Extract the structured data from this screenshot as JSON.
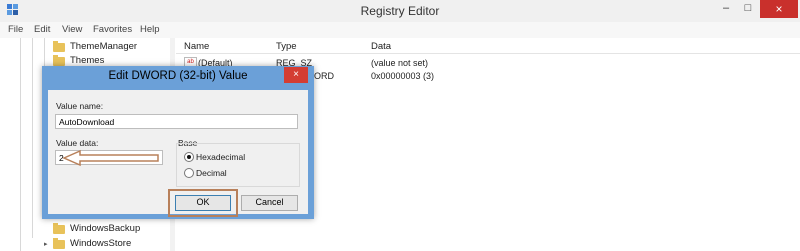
{
  "window": {
    "title": "Registry Editor",
    "close_glyph": "×",
    "minimize_glyph": "–",
    "maximize_glyph": "□"
  },
  "menu": [
    "File",
    "Edit",
    "View",
    "Favorites",
    "Help"
  ],
  "tree": [
    {
      "label": "ThemeManager"
    },
    {
      "label": "Themes"
    },
    {
      "label": "WindowsBackup"
    },
    {
      "label": "WindowsStore"
    }
  ],
  "list": {
    "headers": {
      "name": "Name",
      "type": "Type",
      "data": "Data"
    },
    "rows": [
      {
        "name": "(Default)",
        "type": "REG_SZ",
        "data": "(value not set)"
      },
      {
        "name": "",
        "type": "ORD",
        "data": "0x00000003 (3)"
      }
    ]
  },
  "dialog": {
    "title": "Edit DWORD (32-bit) Value",
    "close_glyph": "×",
    "value_name_label": "Value name:",
    "value_name": "AutoDownload",
    "value_data_label": "Value data:",
    "value_data": "2",
    "base_label": "Base",
    "hex_label": "Hexadecimal",
    "dec_label": "Decimal",
    "ok_label": "OK",
    "cancel_label": "Cancel"
  },
  "colors": {
    "dialog_border": "#6ba0d8",
    "close_red": "#d43d33",
    "annotation": "#b8805a",
    "folder": "#e8c25a"
  },
  "icons": [
    "registry-icon",
    "folder-icon",
    "string-value-icon",
    "arrow-annotation-icon"
  ]
}
